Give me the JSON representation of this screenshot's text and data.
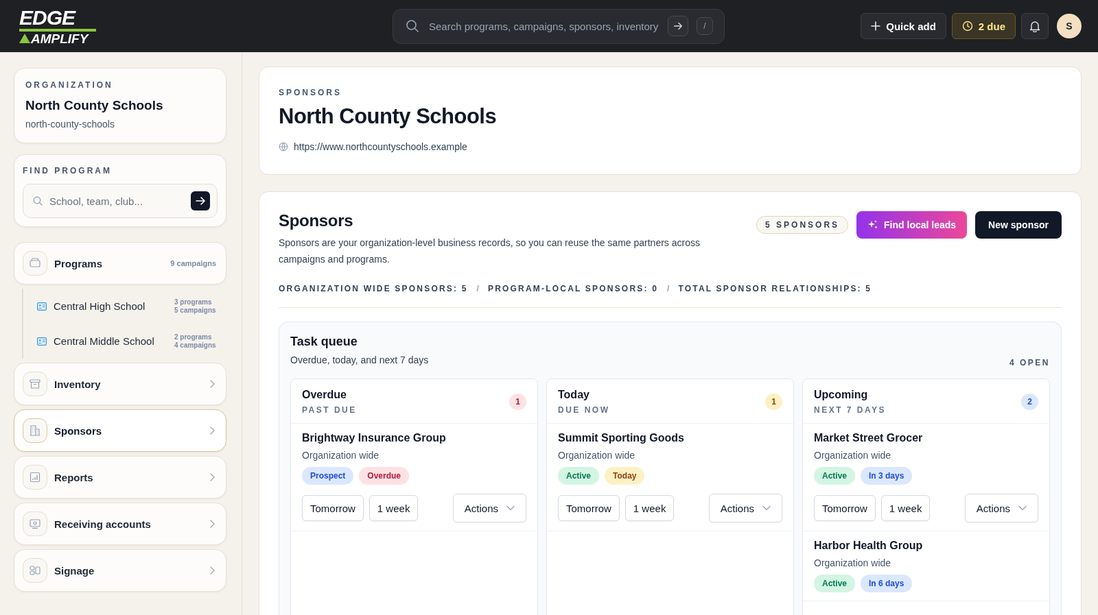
{
  "topbar": {
    "logo": {
      "line1": "EDGE",
      "line2": "AMPLIFY"
    },
    "search": {
      "placeholder": "Search programs, campaigns, sponsors, inventory",
      "shortcut": "/"
    },
    "quick_add": "Quick add",
    "due": "2 due",
    "avatar": "S"
  },
  "sidebar": {
    "organization": {
      "label": "ORGANIZATION",
      "name": "North County Schools",
      "slug": "north-county-schools"
    },
    "find_program": {
      "label": "FIND PROGRAM",
      "placeholder": "School, team, club..."
    },
    "items": [
      {
        "label": "Programs",
        "kind": "group",
        "selected": false,
        "meta": "9 campaigns",
        "children": [
          {
            "label": "Central High School",
            "meta": [
              "3 programs",
              "5 campaigns"
            ]
          },
          {
            "label": "Central Middle School",
            "meta": [
              "2 programs",
              "4 campaigns"
            ]
          }
        ]
      },
      {
        "label": "Inventory",
        "kind": "link",
        "selected": false
      },
      {
        "label": "Sponsors",
        "kind": "link",
        "selected": true
      },
      {
        "label": "Reports",
        "kind": "link",
        "selected": false
      },
      {
        "label": "Receiving accounts",
        "kind": "link",
        "selected": false
      },
      {
        "label": "Signage",
        "kind": "link",
        "selected": false
      }
    ]
  },
  "page_header": {
    "eyebrow": "SPONSORS",
    "title": "North County Schools",
    "url": "https://www.northcountyschools.example"
  },
  "sponsors": {
    "title": "Sponsors",
    "count_badge": "5 SPONSORS",
    "find_leads": "Find local leads",
    "new_sponsor": "New sponsor",
    "description": "Sponsors are your organization-level business records, so you can reuse the same partners across campaigns and programs.",
    "stats": [
      "ORGANIZATION WIDE SPONSORS: 5",
      "PROGRAM-LOCAL SPONSORS: 0",
      "TOTAL SPONSOR RELATIONSHIPS: 5"
    ],
    "separator": "/",
    "task_queue": {
      "title": "Task queue",
      "subtitle": "Overdue, today, and next 7 days",
      "open": "4 OPEN",
      "columns": [
        {
          "title": "Overdue",
          "subtitle": "PAST DUE",
          "count": "1",
          "kind": "overdue",
          "tasks": [
            {
              "name": "Brightway Insurance Group",
              "scope": "Organization wide",
              "tags": [
                {
                  "label": "Prospect",
                  "kind": "prospect"
                },
                {
                  "label": "Overdue",
                  "kind": "overdue"
                }
              ],
              "buttons": [
                "Tomorrow",
                "1 week"
              ],
              "actions": "Actions"
            }
          ]
        },
        {
          "title": "Today",
          "subtitle": "DUE NOW",
          "count": "1",
          "kind": "today",
          "tasks": [
            {
              "name": "Summit Sporting Goods",
              "scope": "Organization wide",
              "tags": [
                {
                  "label": "Active",
                  "kind": "active"
                },
                {
                  "label": "Today",
                  "kind": "today"
                }
              ],
              "buttons": [
                "Tomorrow",
                "1 week"
              ],
              "actions": "Actions"
            }
          ]
        },
        {
          "title": "Upcoming",
          "subtitle": "NEXT 7 DAYS",
          "count": "2",
          "kind": "upcoming",
          "tasks": [
            {
              "name": "Market Street Grocer",
              "scope": "Organization wide",
              "tags": [
                {
                  "label": "Active",
                  "kind": "active"
                },
                {
                  "label": "In 3 days",
                  "kind": "upcoming"
                }
              ],
              "buttons": [
                "Tomorrow",
                "1 week"
              ],
              "actions": "Actions"
            },
            {
              "name": "Harbor Health Group",
              "scope": "Organization wide",
              "tags": [
                {
                  "label": "Active",
                  "kind": "active"
                },
                {
                  "label": "In 6 days",
                  "kind": "upcoming"
                }
              ]
            }
          ]
        }
      ]
    }
  }
}
